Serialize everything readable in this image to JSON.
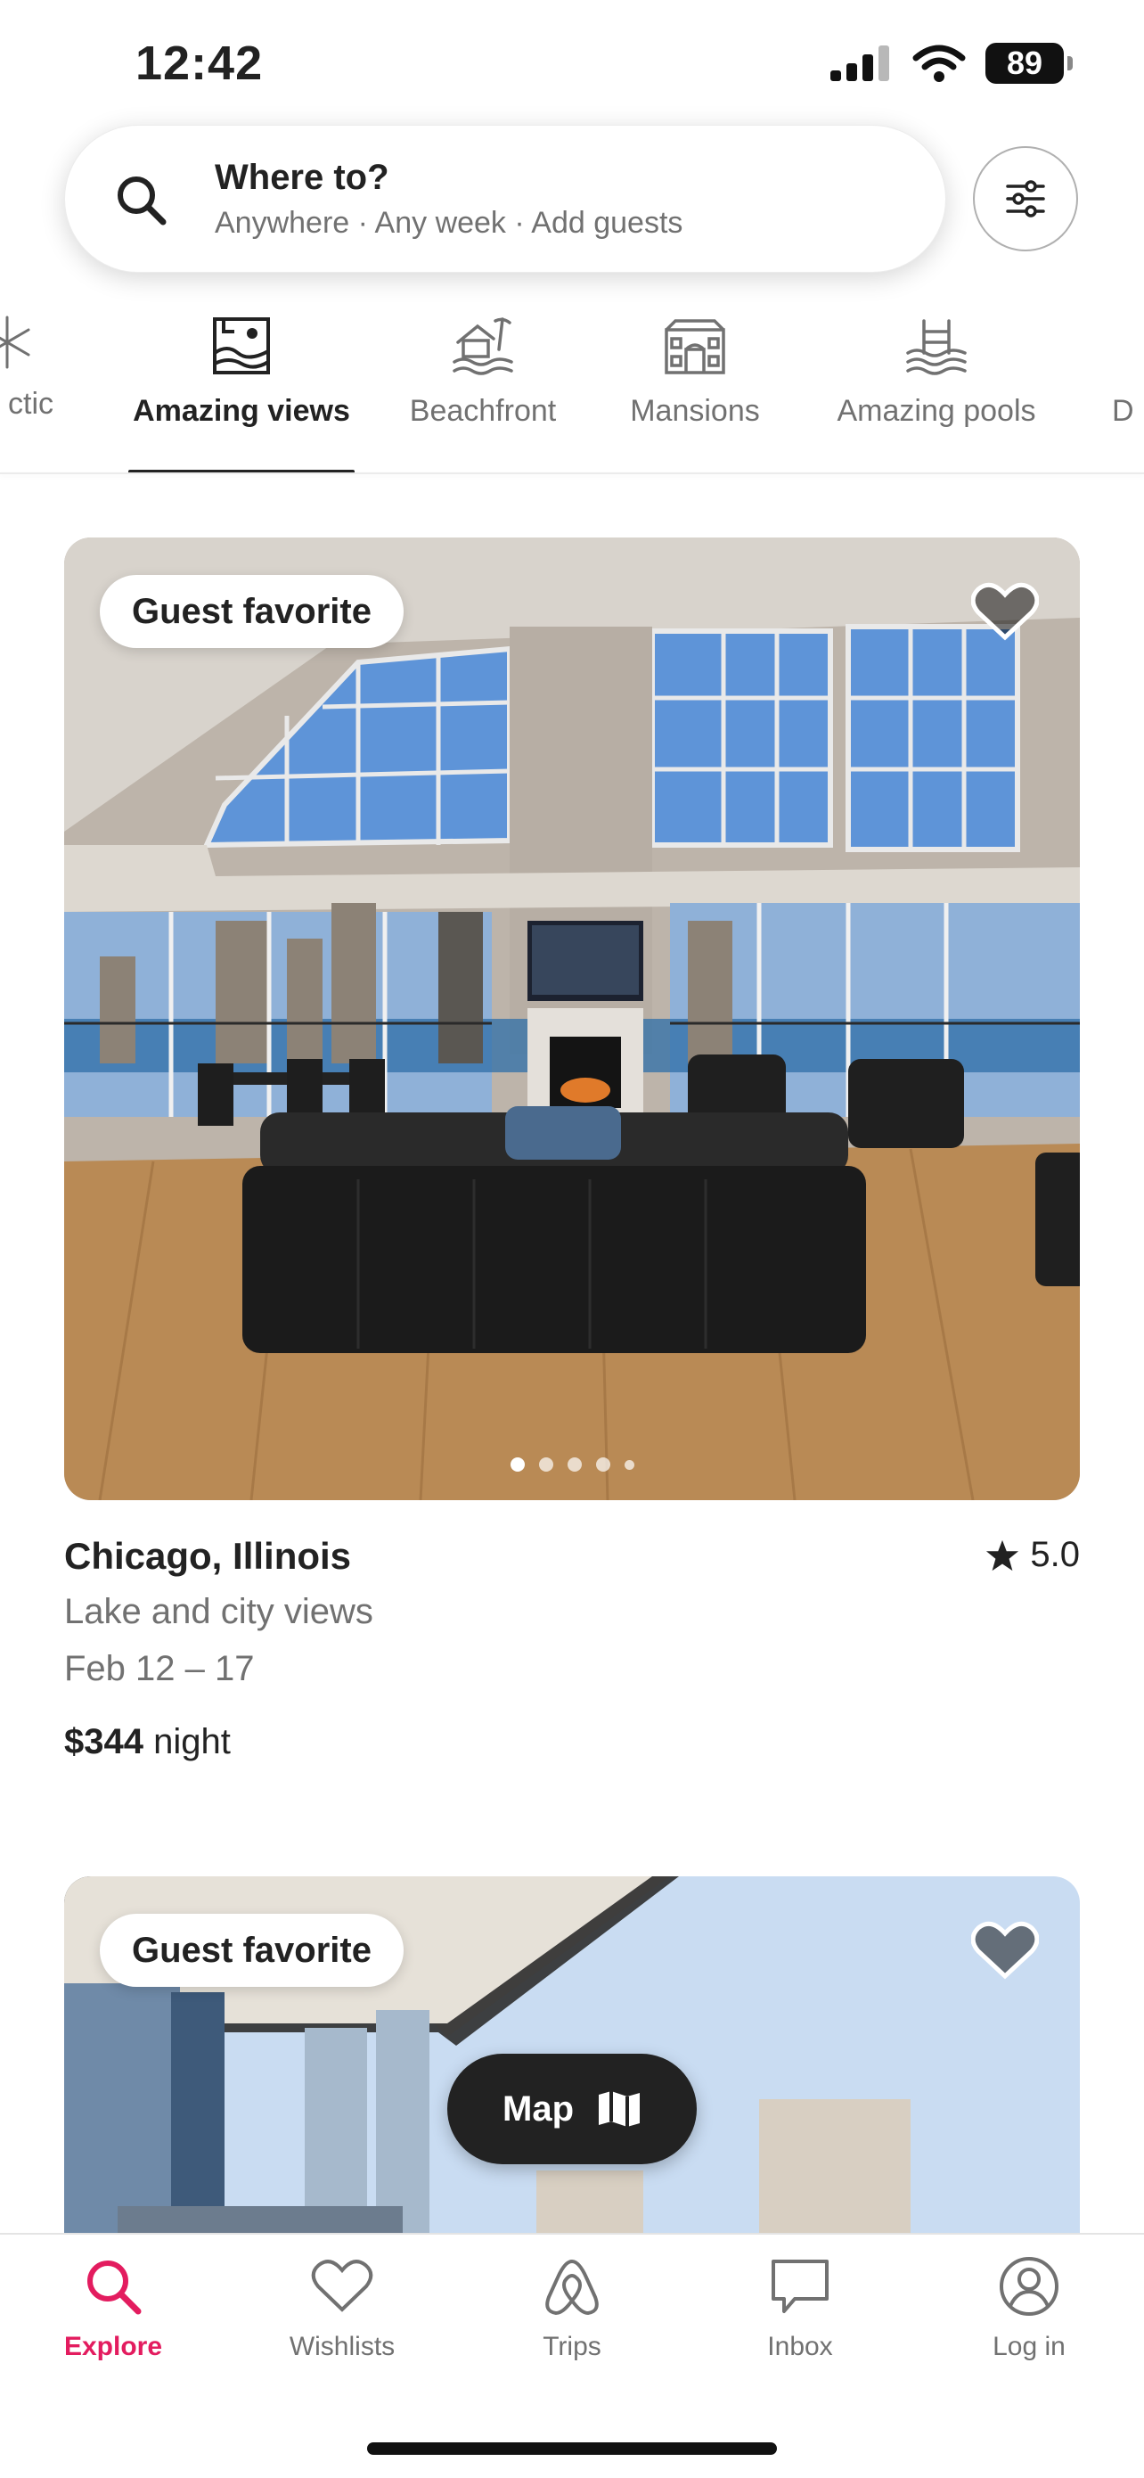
{
  "status": {
    "time": "12:42",
    "battery": "89"
  },
  "search": {
    "title": "Where to?",
    "subtitle": "Anywhere · Any week · Add guests"
  },
  "categories": [
    {
      "label": "ctic",
      "icon": "snowflake-icon"
    },
    {
      "label": "Amazing views",
      "icon": "framed-landscape-icon",
      "active": true
    },
    {
      "label": "Beachfront",
      "icon": "beach-house-icon"
    },
    {
      "label": "Mansions",
      "icon": "mansion-icon"
    },
    {
      "label": "Amazing pools",
      "icon": "pool-icon"
    },
    {
      "label": "D",
      "icon": ""
    }
  ],
  "listings": [
    {
      "badge": "Guest favorite",
      "title": "Chicago, Illinois",
      "rating": "5.0",
      "description": "Lake and city views",
      "dates": "Feb 12 – 17",
      "price": "$344",
      "price_unit": "night",
      "photo_index": 1,
      "photo_count": 5
    },
    {
      "badge": "Guest favorite"
    }
  ],
  "map_button": {
    "label": "Map"
  },
  "tabs": [
    {
      "label": "Explore",
      "icon": "search-icon",
      "active": true
    },
    {
      "label": "Wishlists",
      "icon": "heart-icon"
    },
    {
      "label": "Trips",
      "icon": "airbnb-logo-icon"
    },
    {
      "label": "Inbox",
      "icon": "message-icon"
    },
    {
      "label": "Log in",
      "icon": "profile-icon"
    }
  ],
  "colors": {
    "accent": "#E31C5F",
    "text": "#222222",
    "muted": "#717171"
  }
}
